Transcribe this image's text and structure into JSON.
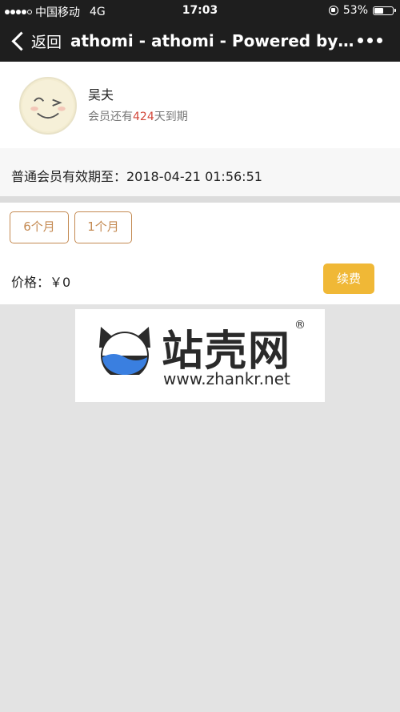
{
  "status_bar": {
    "carrier": "中国移动",
    "network": "4G",
    "time": "17:03",
    "battery": "53%",
    "battery_level": 0.53
  },
  "nav": {
    "back_label": "返回",
    "title": "athomi - athomi - Powered by W..."
  },
  "profile": {
    "name": "吴夫",
    "expiry_prefix": "会员还有",
    "expiry_days": "424",
    "expiry_suffix": "天到期"
  },
  "membership": {
    "validity_text": "普通会员有效期至：2018-04-21 01:56:51"
  },
  "plans": {
    "options": [
      "6个月",
      "1个月"
    ],
    "price_label": "价格：￥0",
    "renew_label": "续费"
  },
  "watermark": {
    "name": "站壳网",
    "url": "www.zhankr.net",
    "reg_mark": "®"
  },
  "colors": {
    "accent": "#c48a52",
    "renew": "#f0b836",
    "days_highlight": "#d2473a"
  }
}
